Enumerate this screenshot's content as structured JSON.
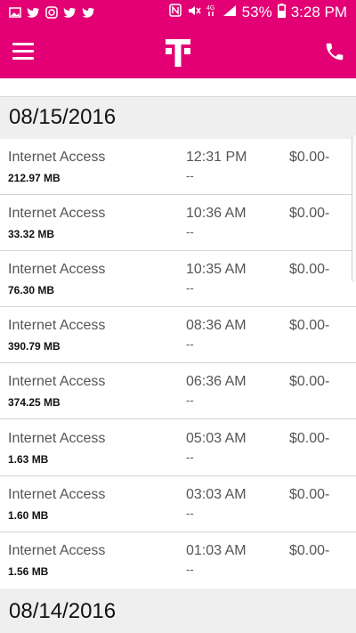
{
  "status_bar": {
    "notification_icons": [
      "image-icon",
      "twitter-icon",
      "camera-icon",
      "twitter-icon",
      "twitter-icon"
    ],
    "battery_percent": "53%",
    "time": "3:28 PM"
  },
  "app_bar": {
    "brand_color": "#e20074"
  },
  "sections": [
    {
      "date": "08/15/2016",
      "items": [
        {
          "service": "Internet Access",
          "size": "212.97 MB",
          "time": "12:31 PM",
          "sub": "--",
          "amount": "$0.00-"
        },
        {
          "service": "Internet Access",
          "size": "33.32 MB",
          "time": "10:36 AM",
          "sub": "--",
          "amount": "$0.00-"
        },
        {
          "service": "Internet Access",
          "size": "76.30 MB",
          "time": "10:35 AM",
          "sub": "--",
          "amount": "$0.00-"
        },
        {
          "service": "Internet Access",
          "size": "390.79 MB",
          "time": "08:36 AM",
          "sub": "--",
          "amount": "$0.00-"
        },
        {
          "service": "Internet Access",
          "size": "374.25 MB",
          "time": "06:36 AM",
          "sub": "--",
          "amount": "$0.00-"
        },
        {
          "service": "Internet Access",
          "size": "1.63 MB",
          "time": "05:03 AM",
          "sub": "--",
          "amount": "$0.00-"
        },
        {
          "service": "Internet Access",
          "size": "1.60 MB",
          "time": "03:03 AM",
          "sub": "--",
          "amount": "$0.00-"
        },
        {
          "service": "Internet Access",
          "size": "1.56 MB",
          "time": "01:03 AM",
          "sub": "--",
          "amount": "$0.00-"
        }
      ]
    },
    {
      "date": "08/14/2016",
      "items": []
    }
  ]
}
